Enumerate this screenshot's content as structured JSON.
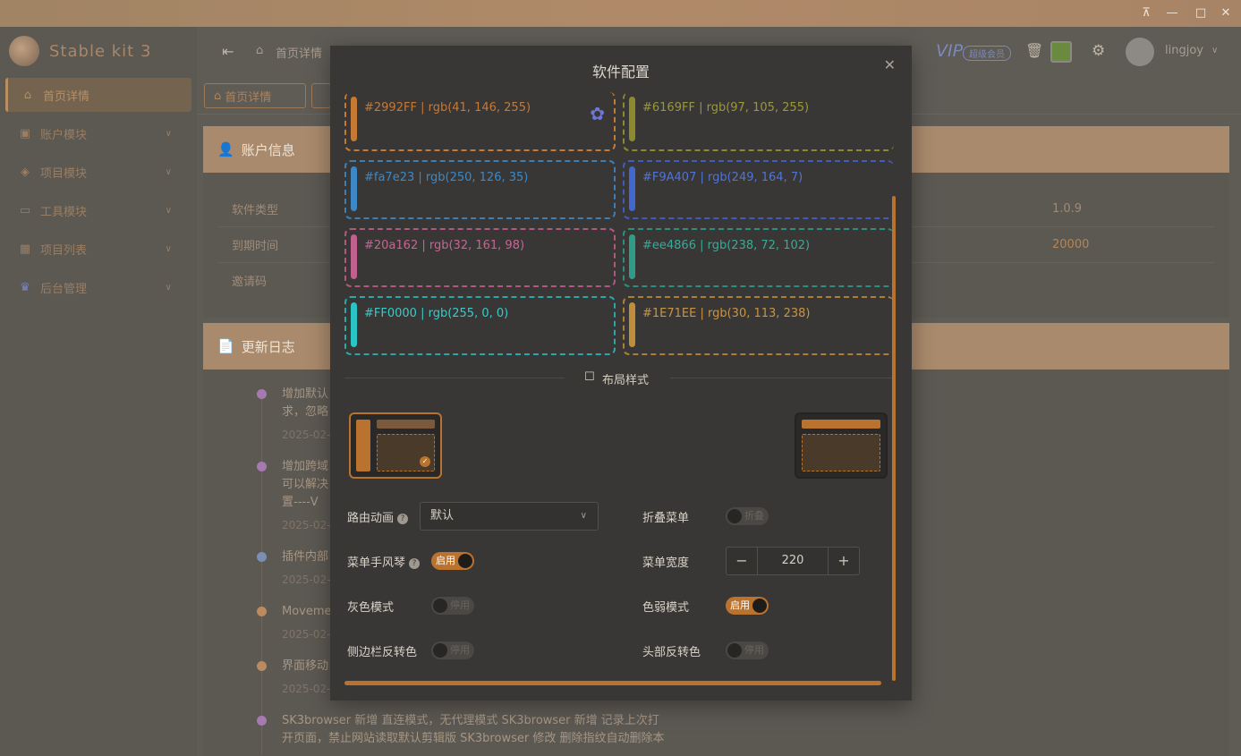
{
  "window": {
    "controls": [
      "⊼",
      "—",
      "□",
      "✕"
    ]
  },
  "app": {
    "name": "Stable kit 3"
  },
  "sidebar": {
    "items": [
      {
        "label": "首页详情",
        "icon": "home-icon"
      },
      {
        "label": "账户模块",
        "icon": "user-badge-icon"
      },
      {
        "label": "项目模块",
        "icon": "layers-icon"
      },
      {
        "label": "工具模块",
        "icon": "briefcase-icon"
      },
      {
        "label": "项目列表",
        "icon": "grid-icon"
      },
      {
        "label": "后台管理",
        "icon": "crown-icon"
      }
    ]
  },
  "header": {
    "breadcrumb": "首页详情",
    "vip_label": "VIP",
    "vip_badge": "超级会员",
    "username": "lingjoy"
  },
  "tabs": [
    {
      "label": "首页详情"
    }
  ],
  "account_card": {
    "title": "账户信息",
    "rows": [
      {
        "label": "软件类型",
        "value": "1.0.9"
      },
      {
        "label": "到期时间",
        "value": "20000"
      },
      {
        "label": "邀请码",
        "value": ""
      }
    ]
  },
  "changelog": {
    "title": "更新日志",
    "entries": [
      {
        "text": "增加默认",
        "text2": "求，忽略",
        "date": "2025-02-",
        "color": "#a67ab0"
      },
      {
        "text": "增加跨域",
        "text2": "可以解决",
        "text3": "置----V",
        "date": "2025-02-",
        "color": "#a67ab0"
      },
      {
        "text": "插件内部",
        "date": "2025-02-",
        "color": "#7b8eb5"
      },
      {
        "text": "Moveme",
        "date": "2025-02-",
        "color": "#bb8a5e"
      },
      {
        "text": "界面移动",
        "date": "2025-02-",
        "color": "#bb8a5e"
      },
      {
        "text": "SK3browser 新增 直连模式，无代理模式 SK3browser 新增 记录上次打",
        "text2": "开页面，禁止网站读取默认剪辑版 SK3browser 修改 删除指纹自动删除本",
        "color": "#a67ab0"
      }
    ]
  },
  "modal": {
    "title": "软件配置",
    "close_icon": "close-icon",
    "swatches": [
      {
        "label": "#2992FF | rgb(41, 146, 255)",
        "color": "#c47a35",
        "bar": "#c47a35",
        "selected": true
      },
      {
        "label": "#6169FF | rgb(97, 105, 255)",
        "color": "#8c8a2c",
        "bar": "#8c8a2c"
      },
      {
        "label": "#fa7e23 | rgb(250, 126, 35)",
        "color": "#3d88c4",
        "bar": "#3d88c4"
      },
      {
        "label": "#F9A407 | rgb(249, 164, 7)",
        "color": "#4168cf",
        "bar": "#4168cf"
      },
      {
        "label": "#20a162 | rgb(32, 161, 98)",
        "color": "#c0608e",
        "bar": "#c0608e"
      },
      {
        "label": "#ee4866 | rgb(238, 72, 102)",
        "color": "#2f9c8a",
        "bar": "#2f9c8a"
      },
      {
        "label": "#FF0000 | rgb(255, 0, 0)",
        "color": "#2ac4c4",
        "bar": "#2ac4c4"
      },
      {
        "label": "#1E71EE | rgb(30, 113, 238)",
        "color": "#c08d3a",
        "bar": "#c08d3a"
      }
    ],
    "layout_section": "布局样式",
    "settings": {
      "route_anim_label": "路由动画",
      "route_anim_value": "默认",
      "collapse_label": "折叠菜单",
      "collapse_state": "折叠",
      "accordion_label": "菜单手风琴",
      "accordion_state": "启用",
      "menu_width_label": "菜单宽度",
      "menu_width_value": "220",
      "gray_label": "灰色模式",
      "gray_state": "停用",
      "weak_label": "色弱模式",
      "weak_state": "启用",
      "sidebar_invert_label": "侧边栏反转色",
      "sidebar_invert_state": "停用",
      "header_invert_label": "头部反转色",
      "header_invert_state": "停用"
    }
  }
}
